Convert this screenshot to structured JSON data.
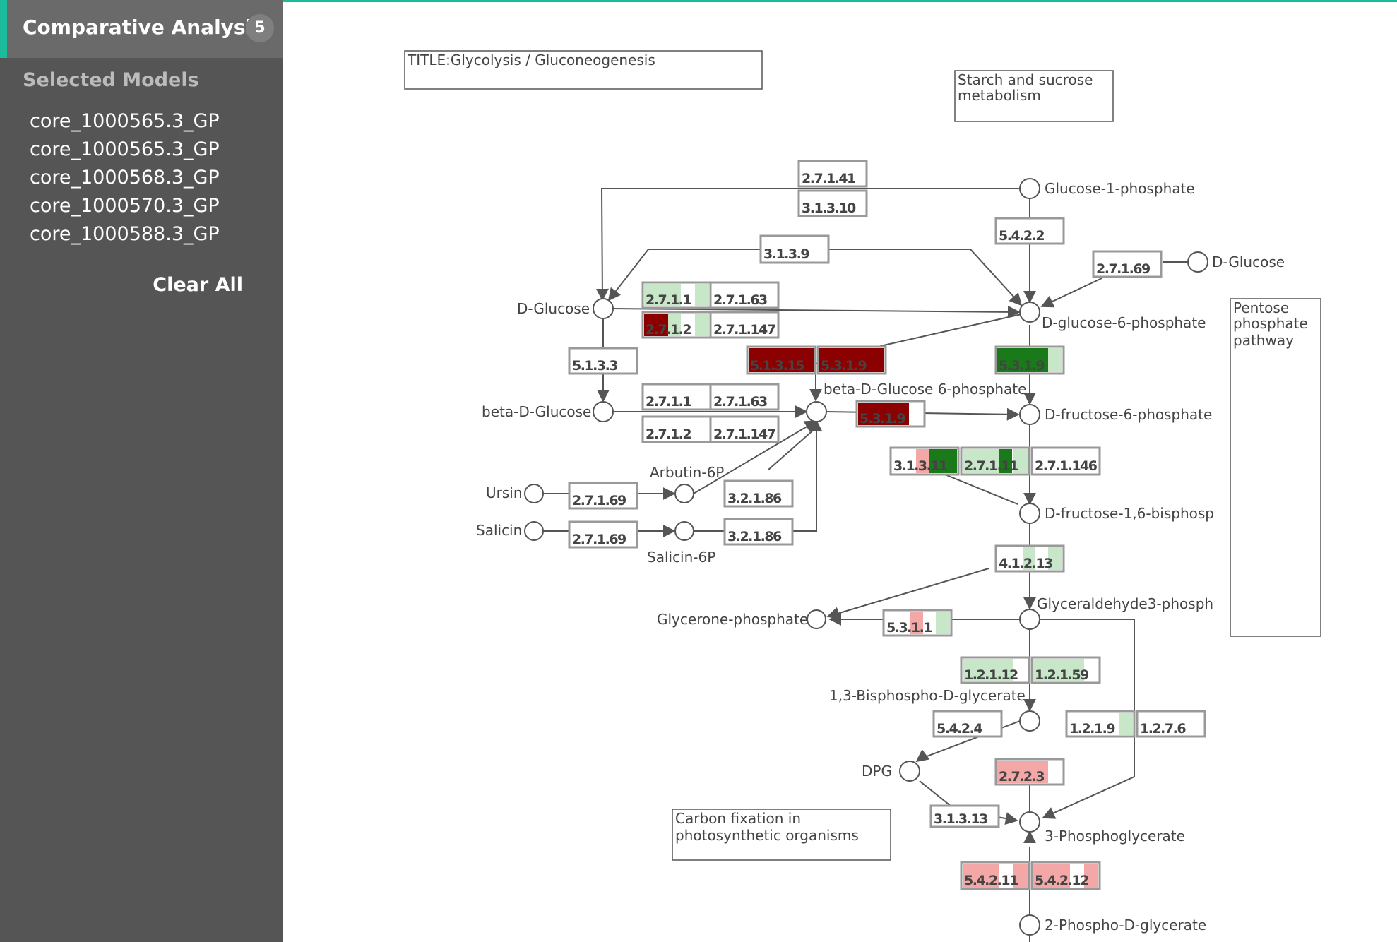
{
  "sidebar": {
    "title": "Comparative Analysis",
    "count": "5",
    "selected_label": "Selected Models",
    "models": [
      "core_1000565.3_GP",
      "core_1000565.3_GP",
      "core_1000568.3_GP",
      "core_1000570.3_GP",
      "core_1000588.3_GP"
    ],
    "clear_label": "Clear All"
  },
  "colors": {
    "accent": "#1abc9c",
    "sidebar_bg": "#555555",
    "dark_red": "#8b0000",
    "light_red": "#f4a7a7",
    "dark_green": "#1a7a1a",
    "light_green": "#c8e6c8"
  },
  "map": {
    "title_box": "TITLE:Glycolysis / Gluconeogenesis",
    "starch_box": [
      "Starch and sucrose",
      "metabolism"
    ],
    "pentose_box": [
      "Pentose",
      "phosphate",
      "pathway"
    ],
    "carbon_box": [
      "Carbon fixation in",
      "photosynthetic organisms"
    ],
    "compounds": {
      "glucose_1_p": "Glucose-1-phosphate",
      "d_glucose_right": "D-Glucose",
      "d_glucose_left": "D-Glucose",
      "d_glucose_6_p": "D-glucose-6-phosphate",
      "beta_d_glucose": "beta-D-Glucose",
      "beta_d_glucose_6p": "beta-D-Glucose 6-phosphate",
      "d_fructose_6_p": "D-fructose-6-phosphate",
      "arbutin_6p": "Arbutin-6P",
      "ursin": "Ursin",
      "salicin": "Salicin",
      "salicin_6p": "Salicin-6P",
      "d_fructose_16": "D-fructose-1,6-bisphosp",
      "gly3p": "Glyceraldehyde3-phosph",
      "glycerone_p": "Glycerone-phosphate",
      "bpg13": "1,3-Bisphospho-D-glycerate",
      "dpg": "DPG",
      "pg3": "3-Phosphoglycerate",
      "pg2": "2-Phospho-D-glycerate"
    },
    "enzymes": {
      "e2_7_1_41": "2.7.1.41",
      "e3_1_3_10": "3.1.3.10",
      "e5_4_2_2": "5.4.2.2",
      "e3_1_3_9": "3.1.3.9",
      "e2_7_1_69_top": "2.7.1.69",
      "e2_7_1_1_a": "2.7.1.1",
      "e2_7_1_63_a": "2.7.1.63",
      "e2_7_1_2_a": "2.7.1.2",
      "e2_7_1_147_a": "2.7.1.147",
      "e5_1_3_3": "5.1.3.3",
      "e5_1_3_15": "5.1.3.15",
      "e5_3_1_9_a": "5.3.1.9",
      "e5_3_1_9_b": "5.3.1.9",
      "e2_7_1_1_b": "2.7.1.1",
      "e2_7_1_63_b": "2.7.1.63",
      "e2_7_1_2_b": "2.7.1.2",
      "e2_7_1_147_b": "2.7.1.147",
      "e5_3_1_9_c": "5.3.1.9",
      "e3_1_3_11": "3.1.3.11",
      "e2_7_1_11": "2.7.1.11",
      "e2_7_1_146": "2.7.1.146",
      "e2_7_1_69_u": "2.7.1.69",
      "e3_2_1_86_u": "3.2.1.86",
      "e2_7_1_69_s": "2.7.1.69",
      "e3_2_1_86_s": "3.2.1.86",
      "e4_1_2_13": "4.1.2.13",
      "e5_3_1_1": "5.3.1.1",
      "e1_2_1_12": "1.2.1.12",
      "e1_2_1_59": "1.2.1.59",
      "e5_4_2_4": "5.4.2.4",
      "e1_2_1_9": "1.2.1.9",
      "e1_2_7_6": "1.2.7.6",
      "e2_7_2_3": "2.7.2.3",
      "e3_1_3_13": "3.1.3.13",
      "e5_4_2_11": "5.4.2.11",
      "e5_4_2_12": "5.4.2.12"
    }
  }
}
